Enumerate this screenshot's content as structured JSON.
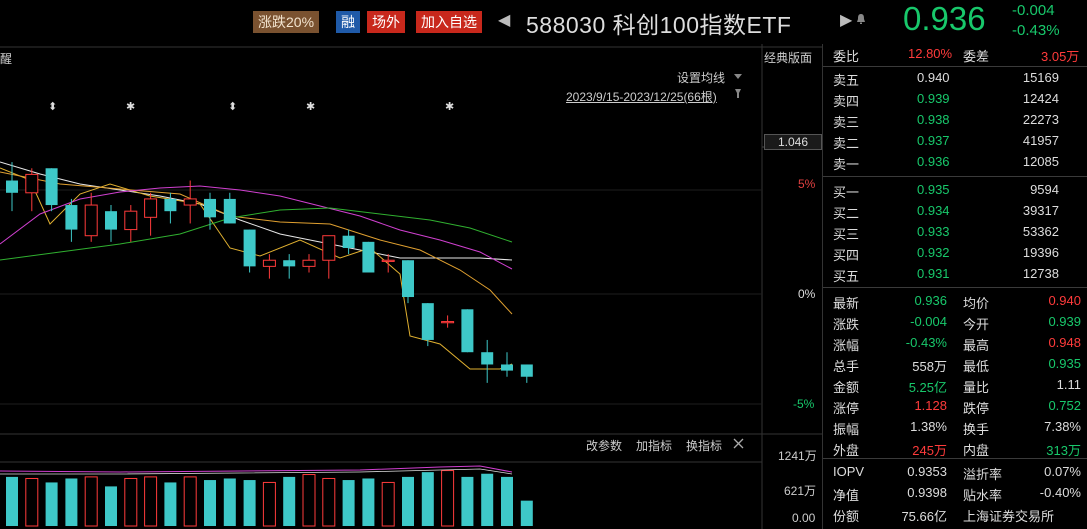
{
  "topbar": {
    "tag_limit": "涨跌20%",
    "tag_margin": "融",
    "tag_offexchange": "场外",
    "tag_add_watch": "加入自选",
    "title": "588030 科创100指数ETF",
    "price": "0.936",
    "change": "-0.004",
    "change_pct": "-0.43%"
  },
  "chart": {
    "left_partial_label": "醒",
    "layout_label": "经典版面",
    "set_ma_label": "设置均线",
    "range_label": "2023/9/15-2023/12/25(66根)",
    "cursor_price": "1.046",
    "y_labels": [
      "5%",
      "0%",
      "-5%"
    ],
    "volume_toolbar": {
      "change_params": "改参数",
      "add_indicator": "加指标",
      "switch_indicator": "换指标"
    },
    "volume_axis": [
      "1241万",
      "621万",
      "0.00"
    ]
  },
  "chart_data": {
    "type": "candlestick",
    "candles": [
      {
        "o": 0.948,
        "h": 0.951,
        "l": 0.943,
        "c": 0.946
      },
      {
        "o": 0.946,
        "h": 0.95,
        "l": 0.943,
        "c": 0.949
      },
      {
        "o": 0.95,
        "h": 0.95,
        "l": 0.943,
        "c": 0.944
      },
      {
        "o": 0.944,
        "h": 0.945,
        "l": 0.938,
        "c": 0.94
      },
      {
        "o": 0.939,
        "h": 0.946,
        "l": 0.938,
        "c": 0.944
      },
      {
        "o": 0.943,
        "h": 0.944,
        "l": 0.938,
        "c": 0.94
      },
      {
        "o": 0.94,
        "h": 0.944,
        "l": 0.938,
        "c": 0.943
      },
      {
        "o": 0.942,
        "h": 0.946,
        "l": 0.939,
        "c": 0.945
      },
      {
        "o": 0.945,
        "h": 0.946,
        "l": 0.941,
        "c": 0.943
      },
      {
        "o": 0.944,
        "h": 0.948,
        "l": 0.941,
        "c": 0.945
      },
      {
        "o": 0.945,
        "h": 0.946,
        "l": 0.94,
        "c": 0.942
      },
      {
        "o": 0.945,
        "h": 0.946,
        "l": 0.941,
        "c": 0.941
      },
      {
        "o": 0.94,
        "h": 0.94,
        "l": 0.933,
        "c": 0.934
      },
      {
        "o": 0.934,
        "h": 0.936,
        "l": 0.932,
        "c": 0.935
      },
      {
        "o": 0.935,
        "h": 0.936,
        "l": 0.932,
        "c": 0.934
      },
      {
        "o": 0.934,
        "h": 0.936,
        "l": 0.933,
        "c": 0.935
      },
      {
        "o": 0.935,
        "h": 0.939,
        "l": 0.932,
        "c": 0.939
      },
      {
        "o": 0.939,
        "h": 0.94,
        "l": 0.936,
        "c": 0.937
      },
      {
        "o": 0.938,
        "h": 0.938,
        "l": 0.933,
        "c": 0.933
      },
      {
        "o": 0.935,
        "h": 0.936,
        "l": 0.933,
        "c": 0.935
      },
      {
        "o": 0.935,
        "h": 0.935,
        "l": 0.928,
        "c": 0.929
      },
      {
        "o": 0.928,
        "h": 0.928,
        "l": 0.921,
        "c": 0.922
      },
      {
        "o": 0.925,
        "h": 0.926,
        "l": 0.924,
        "c": 0.925
      },
      {
        "o": 0.927,
        "h": 0.927,
        "l": 0.92,
        "c": 0.92
      },
      {
        "o": 0.92,
        "h": 0.922,
        "l": 0.915,
        "c": 0.918
      },
      {
        "o": 0.918,
        "h": 0.92,
        "l": 0.916,
        "c": 0.917
      },
      {
        "o": 0.918,
        "h": 0.918,
        "l": 0.915,
        "c": 0.916
      }
    ],
    "volume_max_label": "1241万",
    "volume_mid_label": "621万"
  },
  "quote": {
    "weibi_label": "委比",
    "weibi": "12.80%",
    "weicha_label": "委差",
    "weicha": "3.05万",
    "asks": [
      {
        "label": "卖五",
        "price": "0.940",
        "vol": "15169",
        "color": "w"
      },
      {
        "label": "卖四",
        "price": "0.939",
        "vol": "12424",
        "color": "g"
      },
      {
        "label": "卖三",
        "price": "0.938",
        "vol": "22273",
        "color": "g"
      },
      {
        "label": "卖二",
        "price": "0.937",
        "vol": "41957",
        "color": "g"
      },
      {
        "label": "卖一",
        "price": "0.936",
        "vol": "12085",
        "color": "g"
      }
    ],
    "bids": [
      {
        "label": "买一",
        "price": "0.935",
        "vol": "9594",
        "color": "g"
      },
      {
        "label": "买二",
        "price": "0.934",
        "vol": "39317",
        "color": "g"
      },
      {
        "label": "买三",
        "price": "0.933",
        "vol": "53362",
        "color": "g"
      },
      {
        "label": "买四",
        "price": "0.932",
        "vol": "19396",
        "color": "g"
      },
      {
        "label": "买五",
        "price": "0.931",
        "vol": "12738",
        "color": "g"
      }
    ],
    "stats": [
      {
        "l1": "最新",
        "v1": "0.936",
        "c1": "g",
        "l2": "均价",
        "v2": "0.940",
        "c2": "r"
      },
      {
        "l1": "涨跌",
        "v1": "-0.004",
        "c1": "g",
        "l2": "今开",
        "v2": "0.939",
        "c2": "g"
      },
      {
        "l1": "涨幅",
        "v1": "-0.43%",
        "c1": "g",
        "l2": "最高",
        "v2": "0.948",
        "c2": "r"
      },
      {
        "l1": "总手",
        "v1": "558万",
        "c1": "w",
        "l2": "最低",
        "v2": "0.935",
        "c2": "g"
      },
      {
        "l1": "金额",
        "v1": "5.25亿",
        "c1": "g",
        "l2": "量比",
        "v2": "1.11",
        "c2": "w"
      },
      {
        "l1": "涨停",
        "v1": "1.128",
        "c1": "r",
        "l2": "跌停",
        "v2": "0.752",
        "c2": "g"
      },
      {
        "l1": "振幅",
        "v1": "1.38%",
        "c1": "w",
        "l2": "换手",
        "v2": "7.38%",
        "c2": "w"
      },
      {
        "l1": "外盘",
        "v1": "245万",
        "c1": "r",
        "l2": "内盘",
        "v2": "313万",
        "c2": "g"
      }
    ],
    "extra": [
      {
        "l1": "IOPV",
        "v1": "0.9353",
        "c1": "w",
        "l2": "溢折率",
        "v2": "0.07%",
        "c2": "w"
      },
      {
        "l1": "净值",
        "v1": "0.9398",
        "c1": "w",
        "l2": "贴水率",
        "v2": "-0.40%",
        "c2": "w"
      },
      {
        "l1": "份额",
        "v1": "75.66亿",
        "c1": "w",
        "l2": "上海证券交易所",
        "v2": "",
        "c2": "w"
      }
    ]
  },
  "colors": {
    "up": "#ff3b3b",
    "down": "#3ec8c8",
    "green": "#18c86b",
    "bg": "#000000"
  }
}
